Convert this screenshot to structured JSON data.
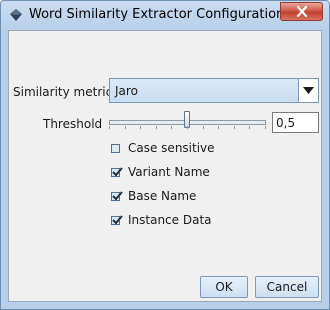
{
  "window": {
    "title": "Word Similarity Extractor Configuration"
  },
  "form": {
    "similarity_label": "Similarity metric",
    "similarity_value": "Jaro",
    "threshold_label": "Threshold",
    "threshold_value": "0,5",
    "threshold_level": 0.5
  },
  "checkboxes": [
    {
      "label": "Case sensitive",
      "checked": false
    },
    {
      "label": "Variant Name",
      "checked": true
    },
    {
      "label": "Base Name",
      "checked": true
    },
    {
      "label": "Instance Data",
      "checked": true
    }
  ],
  "buttons": {
    "ok": "OK",
    "cancel": "Cancel"
  },
  "icons": {
    "app": "diamond-app-icon",
    "close": "close-icon",
    "dropdown": "dropdown-arrow-icon",
    "check": "checkmark-icon"
  },
  "colors": {
    "titlebar": "#b7cfea",
    "close": "#c2422d",
    "panel": "#f0f0f0"
  }
}
